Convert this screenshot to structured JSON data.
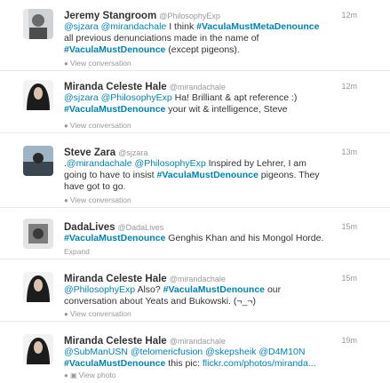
{
  "tweets": [
    {
      "name": "Jeremy Stangroom",
      "handle": "@PhilosophyExp",
      "time": "12m",
      "segments": [
        {
          "t": "@sjzara",
          "k": "link"
        },
        {
          "t": " ",
          "k": "text"
        },
        {
          "t": "@mirandachale",
          "k": "link"
        },
        {
          "t": " I think ",
          "k": "text"
        },
        {
          "t": "#VaculaMustMetaDenounce",
          "k": "hashtag"
        },
        {
          "t": " all previous denunciations made in the name of ",
          "k": "text"
        },
        {
          "t": "#VaculaMustDenounce",
          "k": "hashtag"
        },
        {
          "t": " (except pigeons).",
          "k": "text"
        }
      ],
      "action": {
        "label": "View conversation",
        "icon": "conversation-icon",
        "glyph": "●"
      }
    },
    {
      "name": "Miranda Celeste Hale",
      "handle": "@mirandachale",
      "time": "12m",
      "segments": [
        {
          "t": "@sjzara",
          "k": "link"
        },
        {
          "t": " ",
          "k": "text"
        },
        {
          "t": "@PhilosophyExp",
          "k": "link"
        },
        {
          "t": " Ha! Brilliant & apt reference :) ",
          "k": "text"
        },
        {
          "t": "#VaculaMustDenounce",
          "k": "hashtag"
        },
        {
          "t": " your wit & intelligence, Steve",
          "k": "text"
        }
      ],
      "action": {
        "label": "View conversation",
        "icon": "conversation-icon",
        "glyph": "●"
      }
    },
    {
      "name": "Steve Zara",
      "handle": "@sjzara",
      "time": "13m",
      "segments": [
        {
          "t": ".",
          "k": "text"
        },
        {
          "t": "@mirandachale",
          "k": "link"
        },
        {
          "t": " ",
          "k": "text"
        },
        {
          "t": "@PhilosophyExp",
          "k": "link"
        },
        {
          "t": " Inspired by Lehrer, I am going to have to insist ",
          "k": "text"
        },
        {
          "t": "#VaculaMustDenounce",
          "k": "hashtag"
        },
        {
          "t": " pigeons.  They have got to go.",
          "k": "text"
        }
      ],
      "action": {
        "label": "View conversation",
        "icon": "conversation-icon",
        "glyph": "●"
      }
    },
    {
      "name": "DadaLives",
      "handle": "@DadaLives",
      "time": "15m",
      "segments": [
        {
          "t": "#VaculaMustDenounce",
          "k": "hashtag"
        },
        {
          "t": " Genghis Khan and his Mongol Horde.",
          "k": "text"
        }
      ],
      "action": {
        "label": "Expand",
        "icon": "",
        "glyph": ""
      }
    },
    {
      "name": "Miranda Celeste Hale",
      "handle": "@mirandachale",
      "time": "15m",
      "segments": [
        {
          "t": "@PhilosophyExp",
          "k": "link"
        },
        {
          "t": " Also? ",
          "k": "text"
        },
        {
          "t": "#VaculaMustDenounce",
          "k": "hashtag"
        },
        {
          "t": " our conversation about Yeats and Bukowski.  (¬_¬)",
          "k": "text"
        }
      ],
      "action": {
        "label": "View conversation",
        "icon": "conversation-icon",
        "glyph": "●"
      }
    },
    {
      "name": "Miranda Celeste Hale",
      "handle": "@mirandachale",
      "time": "19m",
      "segments": [
        {
          "t": "@SubManUSN",
          "k": "link"
        },
        {
          "t": " ",
          "k": "text"
        },
        {
          "t": "@telomericfusion",
          "k": "link"
        },
        {
          "t": " ",
          "k": "text"
        },
        {
          "t": "@skepsheik",
          "k": "link"
        },
        {
          "t": " ",
          "k": "text"
        },
        {
          "t": "@D4M10N",
          "k": "link"
        },
        {
          "t": " ",
          "k": "text"
        },
        {
          "t": "#VaculaMustDenounce",
          "k": "hashtag"
        },
        {
          "t": " this pic: ",
          "k": "text"
        },
        {
          "t": "flickr.com/photos/miranda...",
          "k": "link"
        }
      ],
      "action": {
        "label": "View photo",
        "icon": "photo-icon",
        "glyph": "● ▣"
      }
    }
  ],
  "colors": {
    "link": "#0084b4",
    "text": "#333333",
    "muted": "#999999",
    "divider": "#e8e8e8"
  }
}
